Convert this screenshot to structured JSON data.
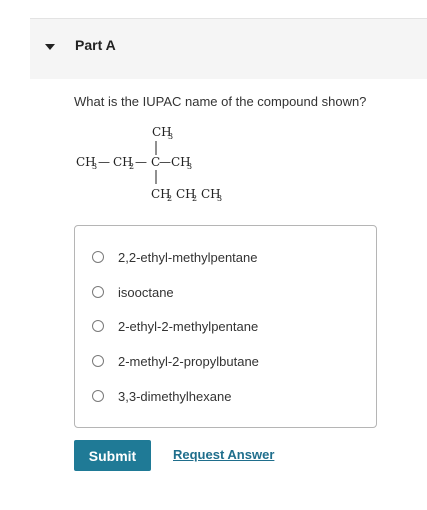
{
  "part": {
    "title": "Part A"
  },
  "question": {
    "prompt": "What is the IUPAC name of the compound shown?"
  },
  "structure": {
    "top": "CH",
    "top_sub": "3",
    "left_ch": "CH",
    "left_sub": "3",
    "left_dash": "—",
    "mid_ch": "CH",
    "mid_sub": "2",
    "mid_dash": "—",
    "center": "C",
    "right_dash": "—",
    "right_ch": "CH",
    "right_sub": "3",
    "b1_ch": "CH",
    "b1_sub": "2",
    "b2_ch": "CH",
    "b2_sub": "2",
    "b3_ch": "CH",
    "b3_sub": "3"
  },
  "options": [
    {
      "label": "2,2-ethyl-methylpentane",
      "selected": false
    },
    {
      "label": "isooctane",
      "selected": false
    },
    {
      "label": "2-ethyl-2-methylpentane",
      "selected": false
    },
    {
      "label": "2-methyl-2-propylbutane",
      "selected": false
    },
    {
      "label": "3,3-dimethylhexane",
      "selected": false
    }
  ],
  "actions": {
    "submit_label": "Submit",
    "request_answer_label": "Request Answer"
  },
  "colors": {
    "submit_bg": "#1f7a96",
    "link": "#1f6e8c",
    "header_bg": "#f5f5f5"
  }
}
